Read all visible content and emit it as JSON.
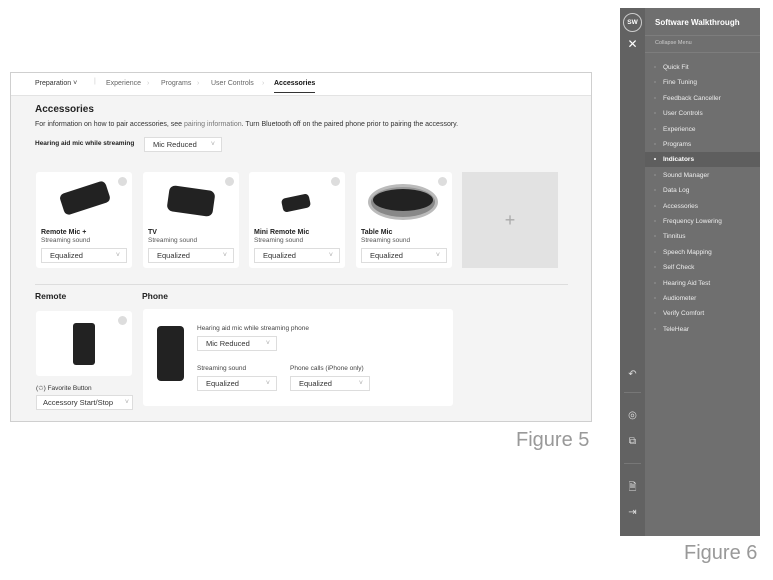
{
  "figure5": {
    "tabs": [
      "Preparation",
      "Experience",
      "Programs",
      "User Controls",
      "Accessories"
    ],
    "title": "Accessories",
    "info_prefix": "For information on how to pair accessories, see ",
    "info_link": "pairing information",
    "info_suffix": ". Turn Bluetooth off on the paired phone prior to pairing the accessory.",
    "mic_label": "Hearing aid mic while streaming",
    "mic_value": "Mic Reduced",
    "cards": [
      {
        "name": "Remote Mic +",
        "sub": "Streaming sound",
        "value": "Equalized"
      },
      {
        "name": "TV",
        "sub": "Streaming sound",
        "value": "Equalized"
      },
      {
        "name": "Mini Remote Mic",
        "sub": "Streaming sound",
        "value": "Equalized"
      },
      {
        "name": "Table Mic",
        "sub": "Streaming sound",
        "value": "Equalized"
      }
    ],
    "add": "+",
    "remote": {
      "title": "Remote",
      "fav_label": "(✩) Favorite Button",
      "fav_value": "Accessory Start/Stop"
    },
    "phone": {
      "title": "Phone",
      "mic_label": "Hearing aid mic while streaming phone",
      "mic_value": "Mic Reduced",
      "stream_label": "Streaming sound",
      "stream_value": "Equalized",
      "calls_label": "Phone calls (iPhone only)",
      "calls_value": "Equalized"
    },
    "caption": "Figure 5"
  },
  "figure6": {
    "avatar": "SW",
    "title": "Software Walkthrough",
    "collapse": "Collapse Menu",
    "items": [
      "Quick Fit",
      "Fine Tuning",
      "Feedback Canceller",
      "User Controls",
      "Experience",
      "Programs",
      "Indicators",
      "Sound Manager",
      "Data Log",
      "Accessories",
      "Frequency Lowering",
      "Tinnitus",
      "Speech Mapping",
      "Self Check",
      "Hearing Aid Test",
      "Audiometer",
      "Verify Comfort",
      "TeleHear"
    ],
    "active": "Indicators",
    "caption": "Figure 6"
  }
}
